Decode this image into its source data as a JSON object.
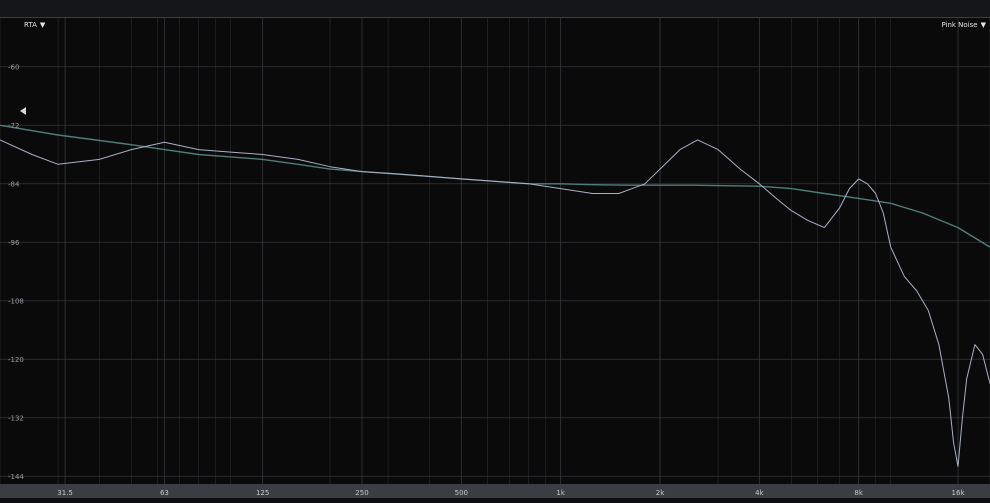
{
  "header": {
    "mode_label": "RTA",
    "signal_label": "Pink Noise",
    "caret": "▼"
  },
  "icons": {
    "dropdown": "caret-down-icon",
    "reference_marker": "triangle-left-icon"
  },
  "colors": {
    "background": "#0a0a0b",
    "grid": "#2a2b2e",
    "tick_label": "#9a9da3",
    "series_teal": "#4f7d78",
    "series_lavender": "#aab0c4",
    "bottom_bar": "#3a3d44"
  },
  "chart_data": {
    "type": "line",
    "xscale": "log",
    "xlim": [
      20,
      20000
    ],
    "ylim": [
      -146,
      -50
    ],
    "grid": true,
    "x_ticks": [
      {
        "v": 31.5,
        "label": "31.5"
      },
      {
        "v": 63,
        "label": "63"
      },
      {
        "v": 125,
        "label": "125"
      },
      {
        "v": 250,
        "label": "250"
      },
      {
        "v": 500,
        "label": "500"
      },
      {
        "v": 1000,
        "label": "1k"
      },
      {
        "v": 2000,
        "label": "2k"
      },
      {
        "v": 4000,
        "label": "4k"
      },
      {
        "v": 8000,
        "label": "8k"
      },
      {
        "v": 16000,
        "label": "16k"
      }
    ],
    "y_ticks": [
      {
        "v": -60,
        "label": "-60"
      },
      {
        "v": -72,
        "label": "-72"
      },
      {
        "v": -84,
        "label": "-84"
      },
      {
        "v": -96,
        "label": "-96"
      },
      {
        "v": -108,
        "label": "-108"
      },
      {
        "v": -120,
        "label": "-120"
      },
      {
        "v": -132,
        "label": "-132"
      },
      {
        "v": -144,
        "label": "-144"
      }
    ],
    "reference_level": -69,
    "series": [
      {
        "color": "#4f7d78",
        "x": [
          20,
          30,
          50,
          63,
          80,
          100,
          125,
          160,
          200,
          250,
          320,
          400,
          500,
          630,
          800,
          1000,
          1250,
          1600,
          2000,
          2500,
          3150,
          4000,
          5000,
          6300,
          8000,
          10000,
          12500,
          16000,
          20000
        ],
        "y": [
          -72,
          -74,
          -76,
          -77,
          -78,
          -78.5,
          -79,
          -80,
          -81,
          -81.5,
          -82,
          -82.5,
          -83,
          -83.5,
          -84,
          -84,
          -84.2,
          -84.3,
          -84.3,
          -84.3,
          -84.4,
          -84.5,
          -85,
          -86,
          -87,
          -88,
          -90,
          -93,
          -97
        ]
      },
      {
        "color": "#aab0c4",
        "x": [
          20,
          25,
          30,
          40,
          50,
          63,
          80,
          100,
          125,
          160,
          200,
          250,
          320,
          400,
          500,
          630,
          800,
          1000,
          1250,
          1500,
          1800,
          2000,
          2300,
          2600,
          3000,
          3500,
          4000,
          4500,
          5000,
          5600,
          6300,
          7000,
          7500,
          8000,
          8500,
          9000,
          9500,
          10000,
          11000,
          12000,
          13000,
          14000,
          15000,
          15500,
          16000,
          16500,
          17000,
          18000,
          19000,
          20000
        ],
        "y": [
          -75,
          -78,
          -80,
          -79,
          -77,
          -75.5,
          -77,
          -77.5,
          -78,
          -79,
          -80.5,
          -81.5,
          -82,
          -82.5,
          -83,
          -83.5,
          -84,
          -85,
          -86,
          -86,
          -84,
          -81,
          -77,
          -75,
          -77,
          -81,
          -84,
          -87,
          -89.5,
          -91.5,
          -93,
          -89,
          -85,
          -83,
          -84,
          -86,
          -90,
          -97,
          -103,
          -106,
          -110,
          -117,
          -128,
          -137,
          -142,
          -132,
          -124,
          -117,
          -119,
          -125
        ]
      }
    ]
  }
}
